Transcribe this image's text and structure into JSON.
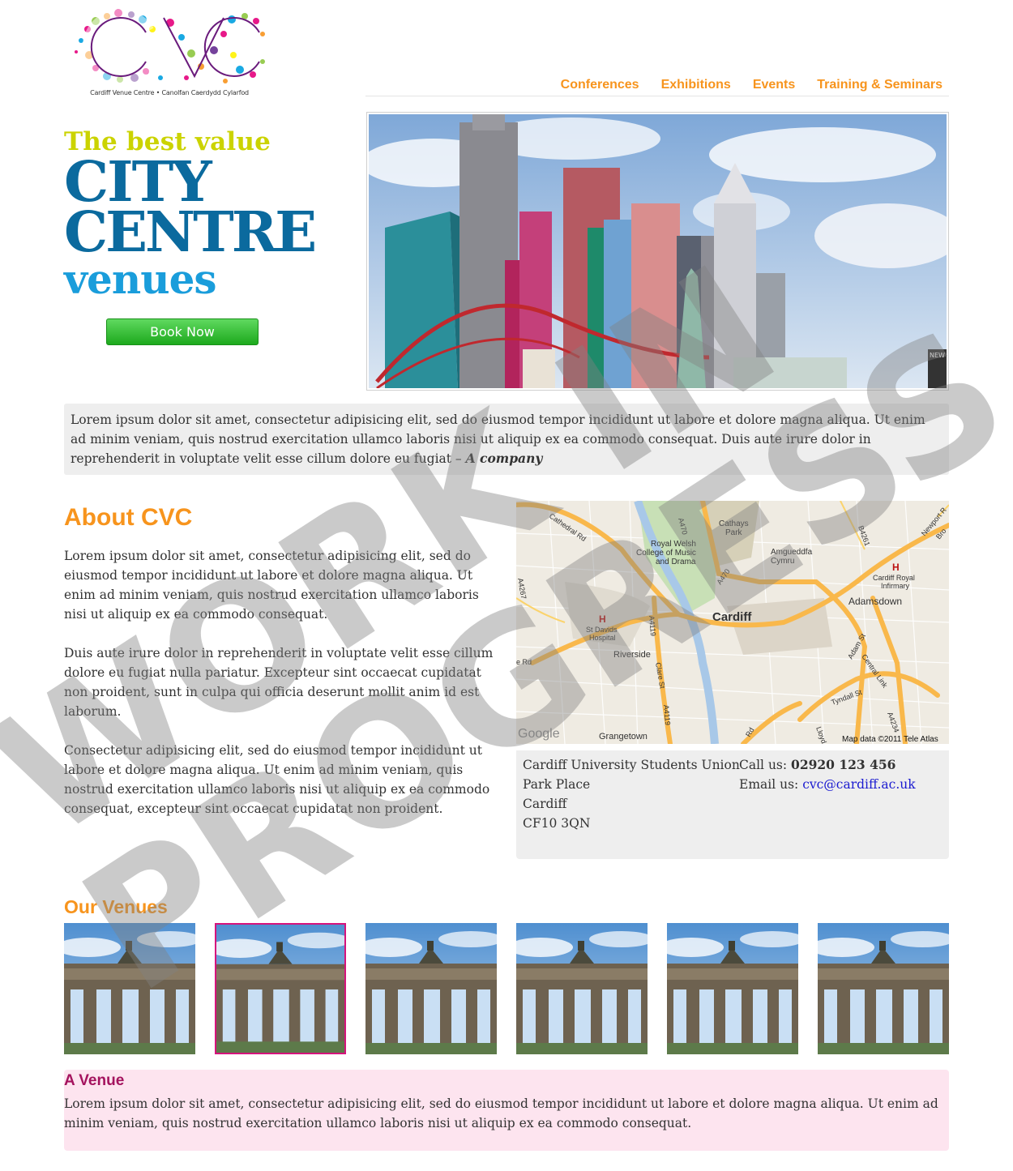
{
  "logo": {
    "text": "CVC",
    "tagline": "Cardiff Venue Centre • Canolfan Caerdydd Cylarfod"
  },
  "nav": {
    "items": [
      "Conferences",
      "Exhibitions",
      "Events",
      "Training & Seminars"
    ]
  },
  "headline": {
    "line1": "The best value",
    "line2": "CITY",
    "line3": "CENTRE",
    "line4": "venues"
  },
  "book_button": "Book Now",
  "hero_sign": "NEW",
  "quote": {
    "text": "Lorem ipsum dolor sit amet, consectetur adipisicing elit, sed do eiusmod tempor incididunt ut labore et dolore magna aliqua. Ut enim ad minim veniam, quis nostrud exercitation ullamco laboris nisi ut aliquip ex ea commodo consequat. Duis aute irure dolor in reprehenderit in voluptate velit esse cillum dolore eu fugiat – ",
    "attribution": "A company"
  },
  "about": {
    "title": "About CVC",
    "paragraphs": [
      "Lorem ipsum dolor sit amet, consectetur adipisicing elit, sed do eiusmod tempor incididunt ut labore et dolore magna aliqua. Ut enim ad minim veniam, quis nostrud exercitation ullamco laboris nisi ut aliquip ex ea commodo consequat.",
      "Duis aute irure dolor in reprehenderit in voluptate velit esse cillum dolore eu fugiat nulla pariatur. Excepteur sint occaecat cupidatat non proident, sunt in culpa qui officia deserunt mollit anim id est laborum.",
      "Consectetur adipisicing elit, sed do eiusmod tempor incididunt ut labore et dolore magna aliqua. Ut enim ad minim veniam, quis nostrud exercitation ullamco laboris nisi ut aliquip ex ea commodo consequat, excepteur sint occaecat cupidatat non proident."
    ]
  },
  "map": {
    "labels": {
      "cardiff": "Cardiff",
      "cathays": "Cathays",
      "park": "Park",
      "rwcmd1": "Royal Welsh",
      "rwcmd2": "College of Music",
      "rwcmd3": "and Drama",
      "amgueddfa1": "Amgueddfa",
      "amgueddfa2": "Cymru",
      "infirmary1": "Cardiff Royal",
      "infirmary2": "Infirmary",
      "adamsdown": "Adamsdown",
      "stdavids1": "St Davids",
      "stdavids2": "Hospital",
      "riverside": "Riverside",
      "grangetown": "Grangetown",
      "cathedral_rd": "Cathedral Rd",
      "a470": "A470",
      "a470b": "A470",
      "a4119": "A4119",
      "a4119b": "A4119",
      "a4267": "A4267",
      "a4234": "A4234",
      "b4261": "B4261",
      "newport_rd": "Newport R",
      "clare_st": "Clare St",
      "adam_st": "Adam St",
      "central_link": "Central Link",
      "tyndall_st": "Tyndall St",
      "lloyd": "Lloyd",
      "rd": "Rd",
      "rd2": "e Rd",
      "bro": "Bro",
      "h": "H",
      "google": "Google",
      "attribution": "Map data ©2011 Tele Atlas"
    }
  },
  "contact": {
    "address": [
      "Cardiff University Students Union",
      "Park Place",
      "Cardiff",
      "CF10 3QN"
    ],
    "call_label": "Call us: ",
    "phone": "02920 123 456",
    "email_label": "Email us: ",
    "email": "cvc@cardiff.ac.uk"
  },
  "venues": {
    "title": "Our Venues",
    "thumbnail_count": 6,
    "selected_index": 1,
    "selected_name": "A Venue",
    "selected_description": "Lorem ipsum dolor sit amet, consectetur adipisicing elit, sed do eiusmod tempor incididunt ut labore et dolore magna aliqua. Ut enim ad minim veniam, quis nostrud exercitation ullamco laboris nisi ut aliquip ex ea commodo consequat."
  },
  "watermark": {
    "line1": "WORK IN",
    "line2": "PROGRESS"
  },
  "colors": {
    "accent_orange": "#f7941d",
    "headline_blue": "#0b6a9e",
    "headline_lightblue": "#1a9ddb",
    "headline_lime": "#cbd300",
    "venue_pink": "#a4135e",
    "venue_bg": "#fde4ef"
  }
}
